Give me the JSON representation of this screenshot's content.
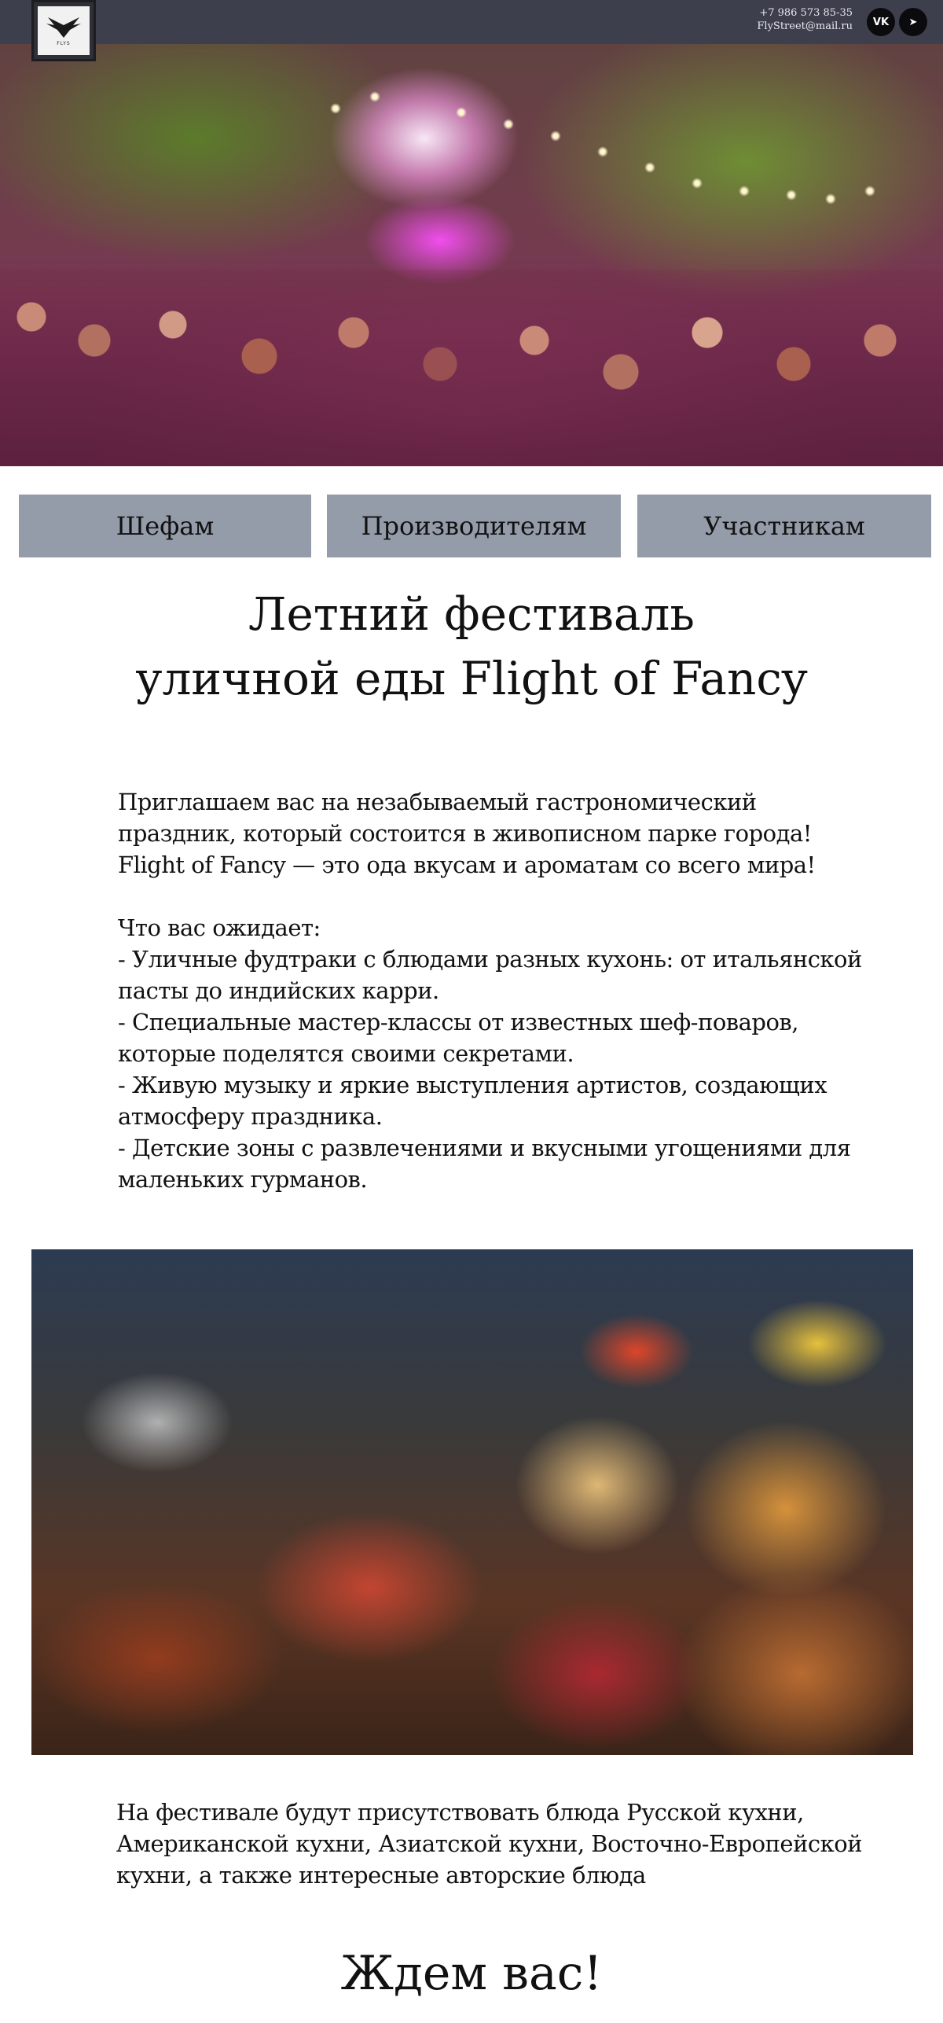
{
  "header": {
    "logo_text": "FLYS",
    "phone": "+7 986 573 85-35",
    "email": "FlyStreet@mail.ru",
    "social": [
      {
        "name": "vk",
        "label": "VK"
      },
      {
        "name": "telegram",
        "label": "➤"
      }
    ]
  },
  "nav": {
    "chefs": "Шефам",
    "producers": "Производителям",
    "participants": "Участникам"
  },
  "title": "Летний фестиваль\nуличной еды Flight of Fancy",
  "intro": "Приглашаем вас на незабываемый гастрономический праздник, который состоится в живописном парке города! Flight of Fancy — это ода вкусам и ароматам со всего мира!\n\n Что вас ожидает:\n- Уличные фудтраки с блюдами разных кухонь: от итальянской пасты до индийских карри.\n- Специальные мастер-классы от известных шеф-поваров, которые поделятся своими секретами.\n- Живую музыку и яркие выступления артистов, создающих атмосферу праздника.\n- Детские зоны с развлечениями и вкусными угощениями для маленьких гурманов.",
  "food_text": "На фестивале будут присутствовать блюда Русской кухни, Американской кухни, Азиатской кухни, Восточно-Европейской кухни, а также интересные авторские блюда",
  "closing": "Ждем вас!"
}
